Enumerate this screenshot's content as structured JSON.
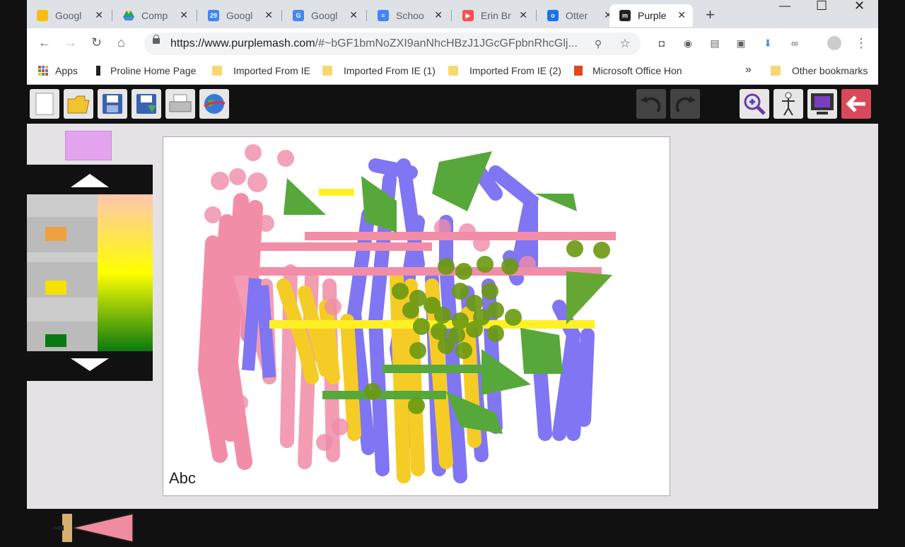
{
  "browser": {
    "tabs": [
      {
        "label": "Googl",
        "icon": "keep-icon",
        "color": "#f9bc15"
      },
      {
        "label": "Comp",
        "icon": "drive-icon",
        "color": "#1fa463"
      },
      {
        "label": "Googl",
        "icon": "calendar-icon",
        "color": "#4285f4",
        "badge": "29"
      },
      {
        "label": "Googl",
        "icon": "translate-icon",
        "color": "#4285f4"
      },
      {
        "label": "Schoo",
        "icon": "docs-icon",
        "color": "#4285f4"
      },
      {
        "label": "Erin Br",
        "icon": "youtube-icon",
        "color": "#ff0000"
      },
      {
        "label": "Otter",
        "icon": "otter-icon",
        "color": "#1a73e8"
      },
      {
        "label": "Purple",
        "icon": "purplemash-icon",
        "color": "#222222"
      }
    ],
    "url_prefix": "https://www.purplemash.com",
    "url_rest": "/#~bGF1bmNoZXI9anNhcHBzJ1JGcGFpbnRhcGlj...",
    "bookmarks": [
      "Apps",
      "Proline Home Page",
      "Imported From IE",
      "Imported From IE (1)",
      "Imported From IE (2)",
      "Microsoft Office Hon",
      "»",
      "Other bookmarks"
    ]
  },
  "canvas": {
    "text_tool_label": "Abc"
  }
}
